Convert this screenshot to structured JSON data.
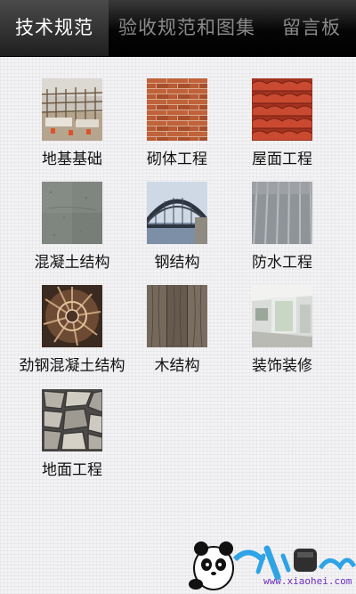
{
  "tabs": [
    {
      "label": "技术规范",
      "active": true
    },
    {
      "label": "验收规范和图集",
      "active": false
    },
    {
      "label": "留言板",
      "active": false
    }
  ],
  "categories": [
    {
      "label": "地基基础",
      "icon": "scaffold-foundation-photo"
    },
    {
      "label": "砌体工程",
      "icon": "brick-wall-photo"
    },
    {
      "label": "屋面工程",
      "icon": "roof-tiles-photo"
    },
    {
      "label": "混凝土结构",
      "icon": "concrete-surface-photo"
    },
    {
      "label": "钢结构",
      "icon": "steel-bridge-photo"
    },
    {
      "label": "防水工程",
      "icon": "waterproof-membrane-photo"
    },
    {
      "label": "劲钢混凝土结构",
      "icon": "steel-rebar-core-photo"
    },
    {
      "label": "木结构",
      "icon": "wood-plank-photo"
    },
    {
      "label": "装饰装修",
      "icon": "interior-room-photo"
    },
    {
      "label": "地面工程",
      "icon": "stone-floor-photo"
    }
  ],
  "watermark": {
    "site": "www.xiaohei.com",
    "logo_text": "小黑游戏"
  },
  "colors": {
    "tab_active": "#ffffff",
    "tab_inactive": "#8a8a8a",
    "tabbar": "#000000",
    "background": "#f3f3f5"
  }
}
